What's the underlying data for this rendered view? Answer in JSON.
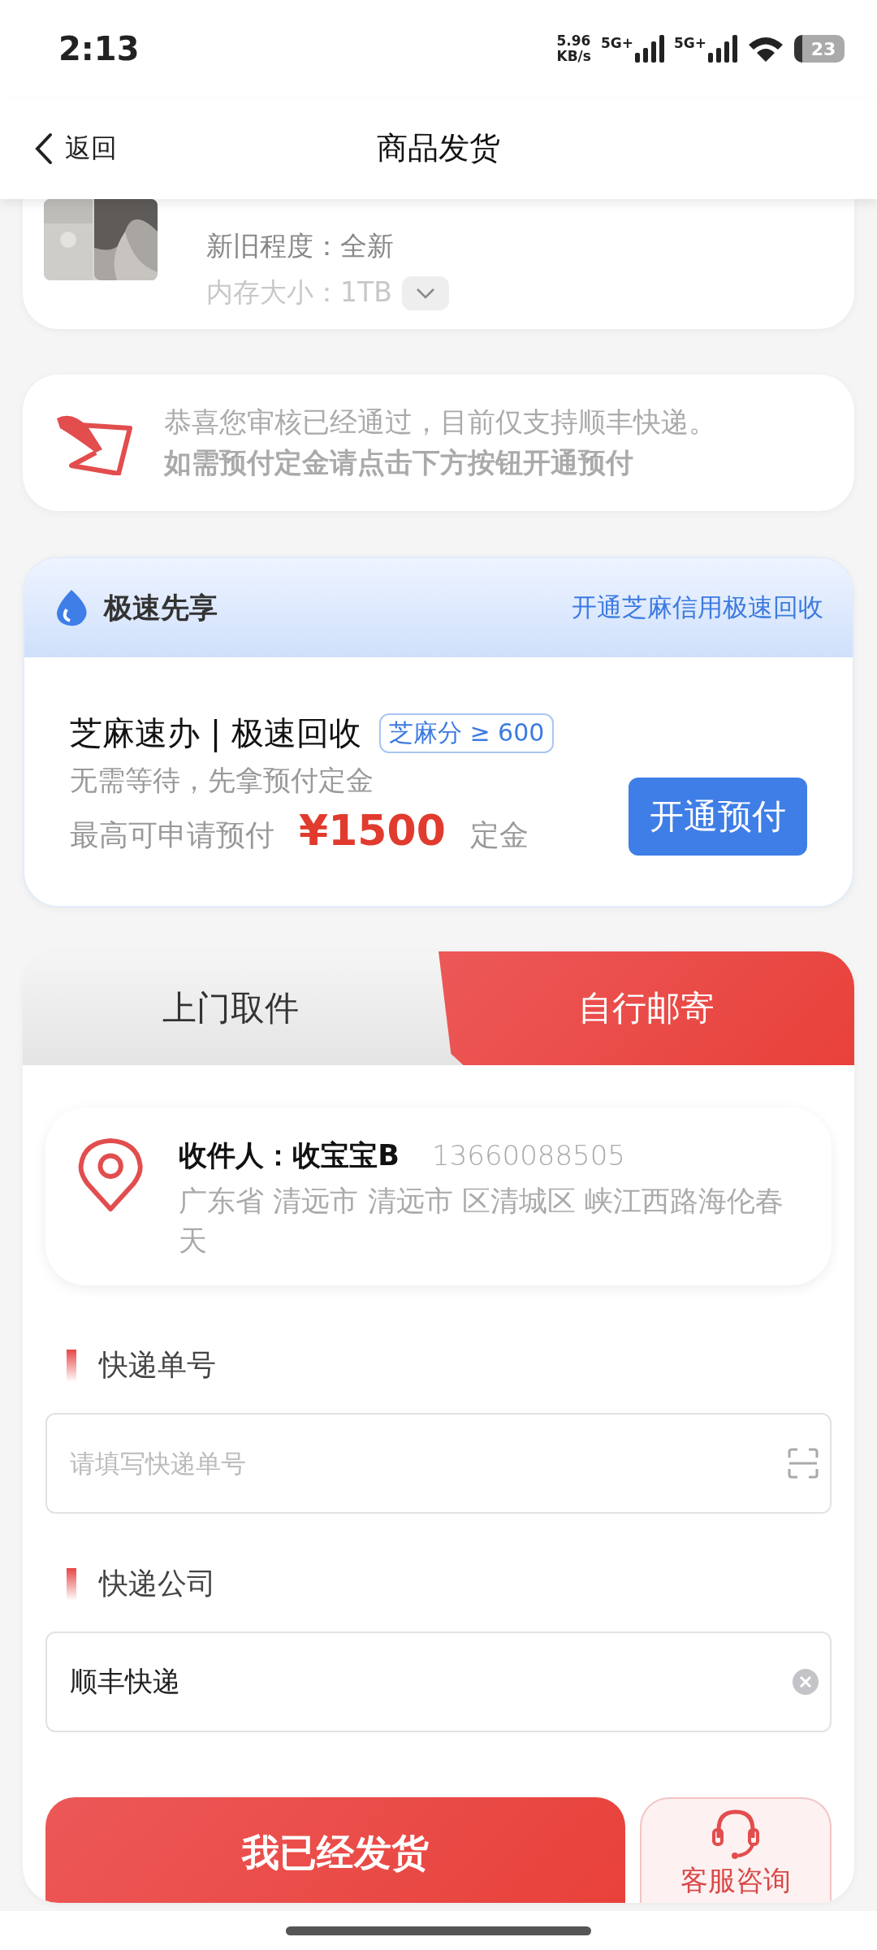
{
  "status_bar": {
    "time": "2:13",
    "net_speed": "5.96",
    "net_unit": "KB/s",
    "signals": [
      "5G+",
      "5G+"
    ],
    "battery": "23"
  },
  "header": {
    "back": "返回",
    "title": "商品发货"
  },
  "product": {
    "details": [
      "新旧程度：全新",
      "内存大小：1TB"
    ]
  },
  "notice": {
    "line1": "恭喜您审核已经通过，目前仅支持顺丰快递。",
    "line2": "如需预付定金请点击下方按钮开通预付"
  },
  "fast_pass": {
    "title": "极速先享",
    "link": "开通芝麻信用极速回收",
    "heading": "芝麻速办 | 极速回收",
    "badge": "芝麻分 ≥ 600",
    "subtitle": "无需等待，先拿预付定金",
    "amount_label": "最高可申请预付",
    "amount": "¥1500",
    "amount_suffix": "定金",
    "button": "开通预付"
  },
  "tabs": [
    {
      "label": "上门取件",
      "selected": false
    },
    {
      "label": "自行邮寄",
      "selected": true
    }
  ],
  "address": {
    "recipient": "收件人：收宝宝B",
    "phone": "13660088505",
    "address": "广东省 清远市 清远市 区清城区 峡江西路海伦春天"
  },
  "fields": [
    {
      "kind": "scan",
      "label": "快递单号",
      "placeholder": "请填写快递单号"
    },
    {
      "kind": "clear",
      "label": "快递公司",
      "value": "顺丰快递"
    }
  ],
  "actions": {
    "primary": "我已经发货",
    "service": "客服咨询"
  }
}
